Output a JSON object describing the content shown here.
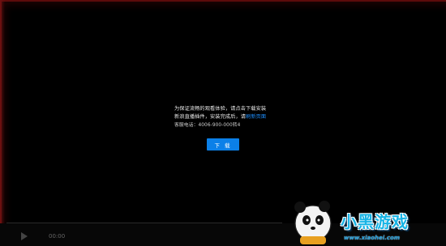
{
  "player": {
    "notice_line1": "为保证流畅的观看体验，请点击下载安装",
    "notice_line2_prefix": "新浪直播插件，安装完成后，请",
    "notice_line2_link": "刷新页面",
    "hotline": "客服电话：4006-900-000转4",
    "download_label": "下 载",
    "time": "00:00"
  },
  "watermark": {
    "brand": "小黑游戏",
    "url": "www.xiaohei.com"
  },
  "colors": {
    "button": "#0b80e8",
    "link": "#1e90ff",
    "brand": "#18b4e6"
  }
}
